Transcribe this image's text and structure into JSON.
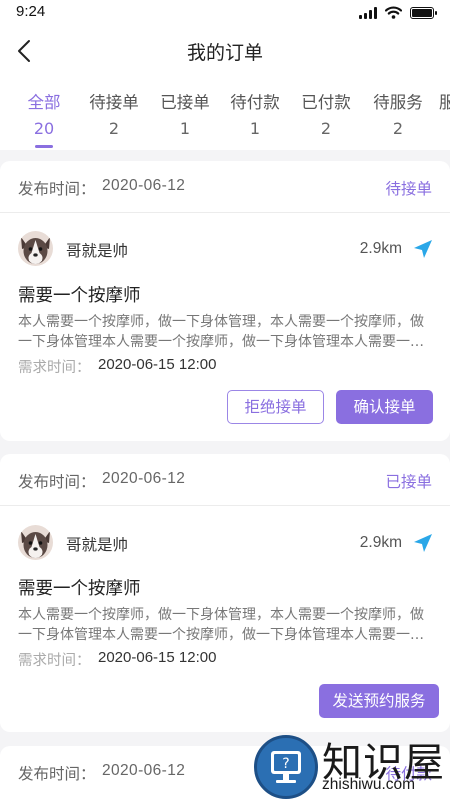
{
  "status_bar": {
    "time": "9:24"
  },
  "header": {
    "title": "我的订单"
  },
  "tabs": [
    {
      "label": "全部",
      "count": "20"
    },
    {
      "label": "待接单",
      "count": "2"
    },
    {
      "label": "已接单",
      "count": "1"
    },
    {
      "label": "待付款",
      "count": "1"
    },
    {
      "label": "已付款",
      "count": "2"
    },
    {
      "label": "待服务",
      "count": "2"
    },
    {
      "label": "服",
      "count": ""
    }
  ],
  "active_tab": "全部",
  "accent_color": "#8a6fe0",
  "orders": [
    {
      "publish_label": "发布时间：",
      "publish_date": "2020-06-12",
      "status": "待接单",
      "user_name": "哥就是帅",
      "distance": "2.9km",
      "title": "需要一个按摩师",
      "description": "本人需要一个按摩师，做一下身体管理，本人需要一个按摩师，做一下身体管理本人需要一个按摩师，做一下身体管理本人需要一个按摩师",
      "need_time_label": "需求时间：",
      "need_time": "2020-06-15 12:00",
      "actions": [
        "拒绝接单",
        "确认接单"
      ]
    },
    {
      "publish_label": "发布时间：",
      "publish_date": "2020-06-12",
      "status": "已接单",
      "user_name": "哥就是帅",
      "distance": "2.9km",
      "title": "需要一个按摩师",
      "description": "本人需要一个按摩师，做一下身体管理，本人需要一个按摩师，做一下身体管理本人需要一个按摩师，做一下身体管理本人需要一个按摩师",
      "need_time_label": "需求时间：",
      "need_time": "2020-06-15 12:00",
      "actions": [
        "发送预约服务"
      ]
    },
    {
      "publish_label": "发布时间：",
      "publish_date": "2020-06-12",
      "status": "待付款"
    }
  ],
  "watermark": {
    "text": "知识屋",
    "sub": "zhishiwu.com"
  }
}
